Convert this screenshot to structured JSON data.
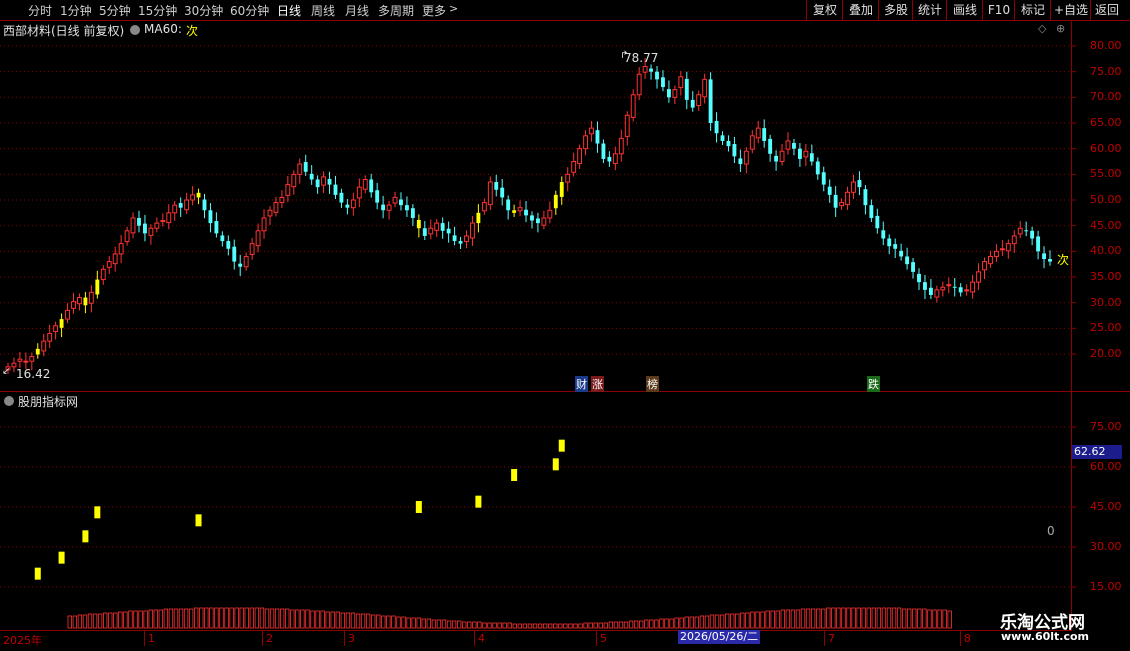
{
  "toolbar": {
    "periods": [
      "分时",
      "1分钟",
      "5分钟",
      "15分钟",
      "30分钟",
      "60分钟",
      "日线",
      "周线",
      "月线",
      "多周期",
      "更多"
    ],
    "active_period": "日线",
    "right_buttons": [
      "复权",
      "叠加",
      "多股",
      "统计",
      "画线",
      "F10",
      "标记",
      "+自选",
      "返回"
    ]
  },
  "header": {
    "stock_title": "西部材料(日线 前复权)",
    "ma_label": "MA60:",
    "ma_value": "次"
  },
  "main_axis": [
    "80.00",
    "75.00",
    "70.00",
    "65.00",
    "60.00",
    "55.00",
    "50.00",
    "45.00",
    "40.00",
    "35.00",
    "30.00",
    "25.00",
    "20.00"
  ],
  "annotations": {
    "high": "78.77",
    "low": "16.42",
    "right_tag": "次",
    "tags": [
      "财",
      "涨",
      "榜",
      "跌"
    ]
  },
  "sub_panel": {
    "title": "股朋指标网",
    "axis": [
      "75.00",
      "60.00",
      "45.00",
      "30.00",
      "15.00"
    ],
    "current_value": "62.62",
    "zero_label": "0"
  },
  "date_bar": {
    "labels": [
      "2025年",
      "1",
      "2",
      "3",
      "4",
      "5",
      "7",
      "8"
    ],
    "cursor": "2026/05/26/二"
  },
  "watermark": {
    "title": "乐淘公式网",
    "url": "www.60lt.com"
  },
  "colors": {
    "up": "#ff3333",
    "down": "#54ffff",
    "signal": "#ffff00",
    "grid": "#8b0000",
    "axis": "#c00000"
  },
  "chart_data": {
    "type": "candlestick",
    "ylim": [
      14,
      82
    ],
    "close_series": [
      17.5,
      18.2,
      19.0,
      18.6,
      19.5,
      21.0,
      22.5,
      24.0,
      25.5,
      26.8,
      28.5,
      30.2,
      31.0,
      29.5,
      32.0,
      34.5,
      36.5,
      38.0,
      39.5,
      41.5,
      44.0,
      46.5,
      45.0,
      43.5,
      44.5,
      45.5,
      46.0,
      47.5,
      49.0,
      48.5,
      50.0,
      51.0,
      50.5,
      48.0,
      45.5,
      43.5,
      42.0,
      40.5,
      38.0,
      37.0,
      39.0,
      41.5,
      44.0,
      46.5,
      48.0,
      49.5,
      50.5,
      53.0,
      55.0,
      57.0,
      55.5,
      54.0,
      52.5,
      54.5,
      53.0,
      51.0,
      49.5,
      48.5,
      50.0,
      52.5,
      54.0,
      51.5,
      49.5,
      48.0,
      49.0,
      50.5,
      49.0,
      48.0,
      46.5,
      44.5,
      43.0,
      44.5,
      45.5,
      44.0,
      43.5,
      42.0,
      41.5,
      43.0,
      45.5,
      47.5,
      49.5,
      53.5,
      52.0,
      50.5,
      48.0,
      47.5,
      48.5,
      47.0,
      46.0,
      45.5,
      46.5,
      48.0,
      51.0,
      53.5,
      55.0,
      57.5,
      60.0,
      62.5,
      64.0,
      61.0,
      58.0,
      57.5,
      59.0,
      62.0,
      66.5,
      70.5,
      74.5,
      76.0,
      75.0,
      73.5,
      72.0,
      70.0,
      71.5,
      74.0,
      69.5,
      68.0,
      70.5,
      73.5,
      65.0,
      63.0,
      61.5,
      60.5,
      58.5,
      57.0,
      59.5,
      62.5,
      64.0,
      61.5,
      59.0,
      57.5,
      59.5,
      61.5,
      60.0,
      58.0,
      59.5,
      57.5,
      55.0,
      53.0,
      51.0,
      48.5,
      49.5,
      51.5,
      53.5,
      52.5,
      49.0,
      46.5,
      44.5,
      42.5,
      41.0,
      40.5,
      39.0,
      37.5,
      36.0,
      34.0,
      32.5,
      31.5,
      32.5,
      33.0,
      33.5,
      33.0,
      32.0,
      32.5,
      34.0,
      36.0,
      38.0,
      39.0,
      40.0,
      40.5,
      41.5,
      43.0,
      44.5,
      44.0,
      42.5,
      40.0,
      38.5,
      38.0
    ],
    "high": 78.77,
    "low": 16.42,
    "indicator_signals": [
      [
        5,
        20
      ],
      [
        9,
        26
      ],
      [
        13,
        34
      ],
      [
        15,
        43
      ],
      [
        32,
        40
      ],
      [
        69,
        45
      ],
      [
        79,
        47
      ],
      [
        85,
        57
      ],
      [
        92,
        61
      ],
      [
        93,
        68
      ]
    ],
    "volume_base": 6
  }
}
